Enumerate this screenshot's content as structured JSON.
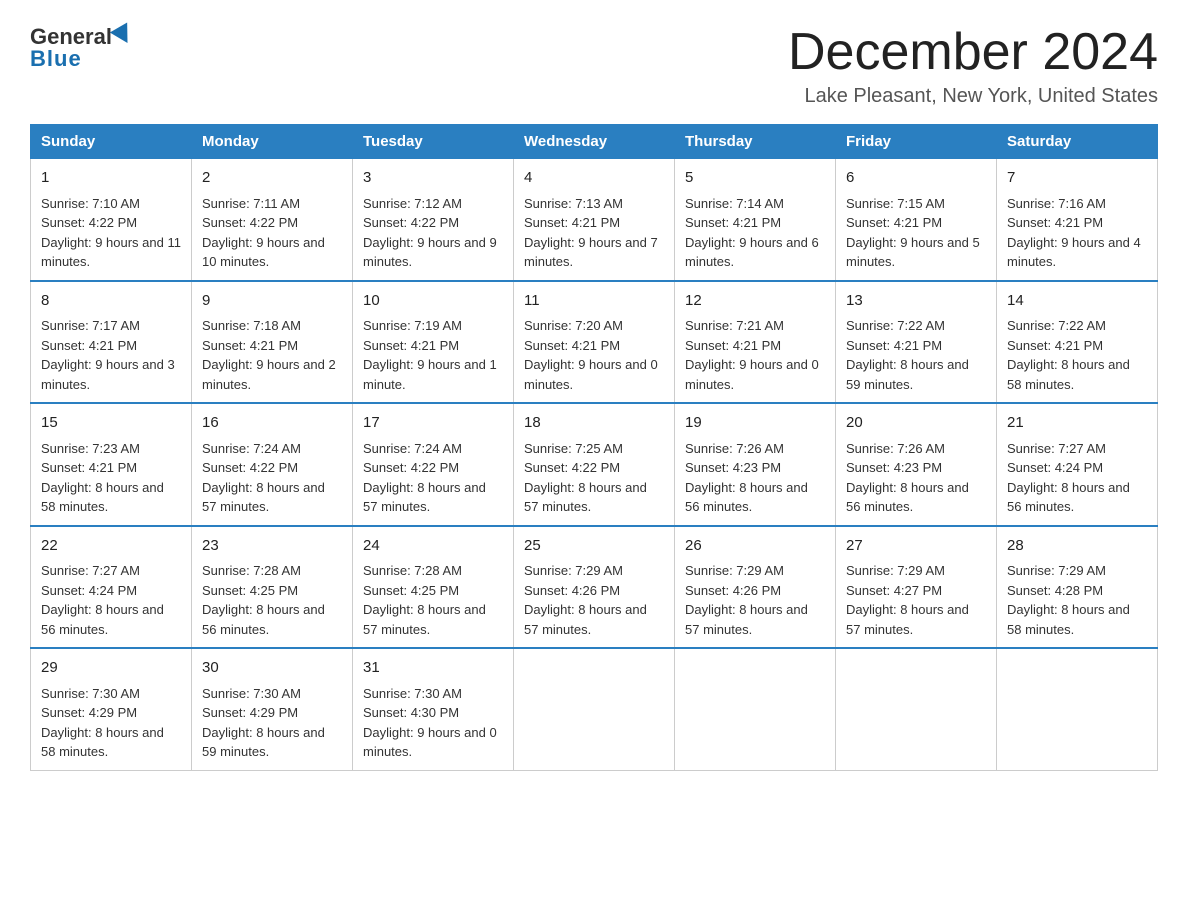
{
  "logo": {
    "general": "General",
    "blue": "Blue"
  },
  "title": "December 2024",
  "subtitle": "Lake Pleasant, New York, United States",
  "headers": [
    "Sunday",
    "Monday",
    "Tuesday",
    "Wednesday",
    "Thursday",
    "Friday",
    "Saturday"
  ],
  "weeks": [
    [
      {
        "day": "1",
        "sunrise": "7:10 AM",
        "sunset": "4:22 PM",
        "daylight": "9 hours and 11 minutes."
      },
      {
        "day": "2",
        "sunrise": "7:11 AM",
        "sunset": "4:22 PM",
        "daylight": "9 hours and 10 minutes."
      },
      {
        "day": "3",
        "sunrise": "7:12 AM",
        "sunset": "4:22 PM",
        "daylight": "9 hours and 9 minutes."
      },
      {
        "day": "4",
        "sunrise": "7:13 AM",
        "sunset": "4:21 PM",
        "daylight": "9 hours and 7 minutes."
      },
      {
        "day": "5",
        "sunrise": "7:14 AM",
        "sunset": "4:21 PM",
        "daylight": "9 hours and 6 minutes."
      },
      {
        "day": "6",
        "sunrise": "7:15 AM",
        "sunset": "4:21 PM",
        "daylight": "9 hours and 5 minutes."
      },
      {
        "day": "7",
        "sunrise": "7:16 AM",
        "sunset": "4:21 PM",
        "daylight": "9 hours and 4 minutes."
      }
    ],
    [
      {
        "day": "8",
        "sunrise": "7:17 AM",
        "sunset": "4:21 PM",
        "daylight": "9 hours and 3 minutes."
      },
      {
        "day": "9",
        "sunrise": "7:18 AM",
        "sunset": "4:21 PM",
        "daylight": "9 hours and 2 minutes."
      },
      {
        "day": "10",
        "sunrise": "7:19 AM",
        "sunset": "4:21 PM",
        "daylight": "9 hours and 1 minute."
      },
      {
        "day": "11",
        "sunrise": "7:20 AM",
        "sunset": "4:21 PM",
        "daylight": "9 hours and 0 minutes."
      },
      {
        "day": "12",
        "sunrise": "7:21 AM",
        "sunset": "4:21 PM",
        "daylight": "9 hours and 0 minutes."
      },
      {
        "day": "13",
        "sunrise": "7:22 AM",
        "sunset": "4:21 PM",
        "daylight": "8 hours and 59 minutes."
      },
      {
        "day": "14",
        "sunrise": "7:22 AM",
        "sunset": "4:21 PM",
        "daylight": "8 hours and 58 minutes."
      }
    ],
    [
      {
        "day": "15",
        "sunrise": "7:23 AM",
        "sunset": "4:21 PM",
        "daylight": "8 hours and 58 minutes."
      },
      {
        "day": "16",
        "sunrise": "7:24 AM",
        "sunset": "4:22 PM",
        "daylight": "8 hours and 57 minutes."
      },
      {
        "day": "17",
        "sunrise": "7:24 AM",
        "sunset": "4:22 PM",
        "daylight": "8 hours and 57 minutes."
      },
      {
        "day": "18",
        "sunrise": "7:25 AM",
        "sunset": "4:22 PM",
        "daylight": "8 hours and 57 minutes."
      },
      {
        "day": "19",
        "sunrise": "7:26 AM",
        "sunset": "4:23 PM",
        "daylight": "8 hours and 56 minutes."
      },
      {
        "day": "20",
        "sunrise": "7:26 AM",
        "sunset": "4:23 PM",
        "daylight": "8 hours and 56 minutes."
      },
      {
        "day": "21",
        "sunrise": "7:27 AM",
        "sunset": "4:24 PM",
        "daylight": "8 hours and 56 minutes."
      }
    ],
    [
      {
        "day": "22",
        "sunrise": "7:27 AM",
        "sunset": "4:24 PM",
        "daylight": "8 hours and 56 minutes."
      },
      {
        "day": "23",
        "sunrise": "7:28 AM",
        "sunset": "4:25 PM",
        "daylight": "8 hours and 56 minutes."
      },
      {
        "day": "24",
        "sunrise": "7:28 AM",
        "sunset": "4:25 PM",
        "daylight": "8 hours and 57 minutes."
      },
      {
        "day": "25",
        "sunrise": "7:29 AM",
        "sunset": "4:26 PM",
        "daylight": "8 hours and 57 minutes."
      },
      {
        "day": "26",
        "sunrise": "7:29 AM",
        "sunset": "4:26 PM",
        "daylight": "8 hours and 57 minutes."
      },
      {
        "day": "27",
        "sunrise": "7:29 AM",
        "sunset": "4:27 PM",
        "daylight": "8 hours and 57 minutes."
      },
      {
        "day": "28",
        "sunrise": "7:29 AM",
        "sunset": "4:28 PM",
        "daylight": "8 hours and 58 minutes."
      }
    ],
    [
      {
        "day": "29",
        "sunrise": "7:30 AM",
        "sunset": "4:29 PM",
        "daylight": "8 hours and 58 minutes."
      },
      {
        "day": "30",
        "sunrise": "7:30 AM",
        "sunset": "4:29 PM",
        "daylight": "8 hours and 59 minutes."
      },
      {
        "day": "31",
        "sunrise": "7:30 AM",
        "sunset": "4:30 PM",
        "daylight": "9 hours and 0 minutes."
      },
      null,
      null,
      null,
      null
    ]
  ]
}
